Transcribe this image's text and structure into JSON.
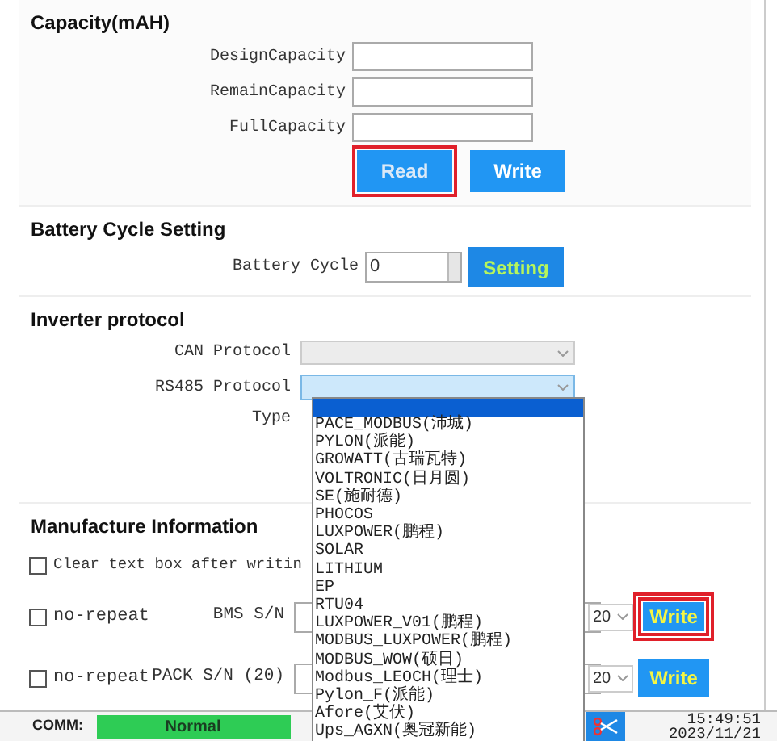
{
  "capacity": {
    "title": "Capacity(mAH)",
    "fields": [
      {
        "label": "DesignCapacity"
      },
      {
        "label": "RemainCapacity"
      },
      {
        "label": "FullCapacity"
      }
    ],
    "buttons": [
      {
        "label": "Read",
        "highlighted": true
      },
      {
        "label": "Write",
        "highlighted": false
      }
    ]
  },
  "battery_cycle": {
    "title": "Battery Cycle Setting",
    "label": "Battery Cycle",
    "value": "0",
    "button": "Setting"
  },
  "inverter": {
    "title": "Inverter protocol",
    "can_label": "CAN Protocol",
    "can_disabled": true,
    "rs485_label": "RS485 Protocol",
    "type_label": "Type",
    "dropdown": {
      "expanded": true,
      "blank_option_selected": true,
      "options": [
        {
          "label": "PACE_MODBUS(沛城)"
        },
        {
          "label": "PYLON(派能)"
        },
        {
          "label": "GROWATT(古瑞瓦特)"
        },
        {
          "label": "VOLTRONIC(日月圆)"
        },
        {
          "label": "SE(施耐德)"
        },
        {
          "label": "PHOCOS"
        },
        {
          "label": "LUXPOWER(鹏程)"
        },
        {
          "label": "SOLAR"
        },
        {
          "label": "LITHIUM"
        },
        {
          "label": "EP"
        },
        {
          "label": "RTU04"
        },
        {
          "label": "LUXPOWER_V01(鹏程)"
        },
        {
          "label": "MODBUS_LUXPOWER(鹏程)"
        },
        {
          "label": "MODBUS_WOW(硕日)"
        },
        {
          "label": "Modbus_LEOCH(理士)"
        },
        {
          "label": "Pylon_F(派能)"
        },
        {
          "label": "Afore(艾伏)"
        },
        {
          "label": "Ups_AGXN(奥冠新能)"
        }
      ]
    }
  },
  "manufacture": {
    "title": "Manufacture Information",
    "clear_option": {
      "label": "Clear text box after writin",
      "checked": false
    },
    "rows": [
      {
        "no_repeat": {
          "label": "no-repeat",
          "checked": false
        },
        "label": "BMS S/N",
        "length": "20",
        "button": {
          "label": "Write",
          "highlighted": true
        }
      },
      {
        "no_repeat": {
          "label": "no-repeat",
          "checked": false
        },
        "label": "PACK S/N (20)",
        "length": "20",
        "button": {
          "label": "Write",
          "highlighted": false
        }
      }
    ]
  },
  "status_bar": {
    "comm_label": "COMM:",
    "comm_status": "Normal",
    "time": "15:49:51",
    "date": "2023/11/21"
  }
}
